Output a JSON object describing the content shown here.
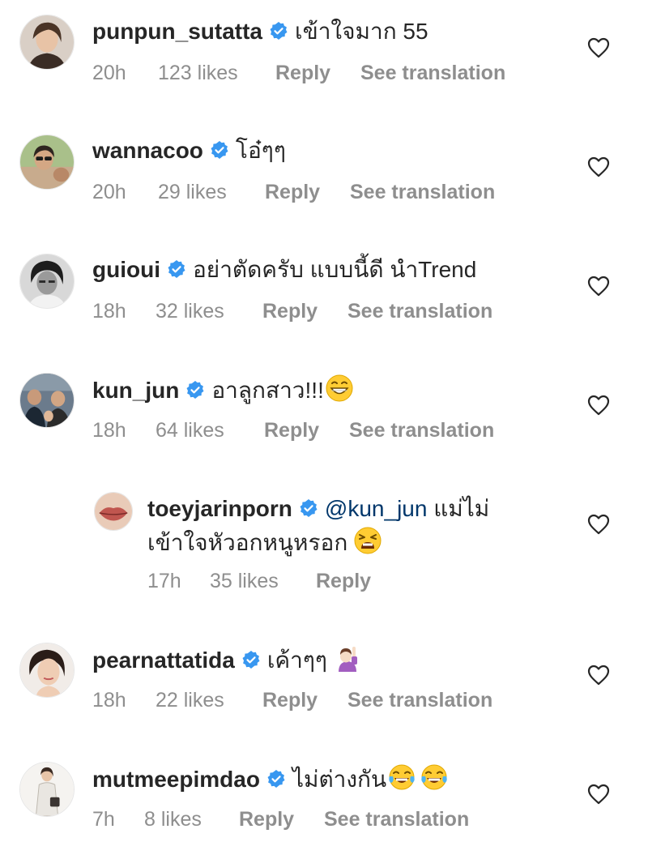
{
  "colors": {
    "text": "#262626",
    "secondary": "#8e8e8e",
    "verified": "#3897f0",
    "mention": "#00376b"
  },
  "comments": [
    {
      "username": "punpun_sutatta",
      "text": "เข้าใจมาก 55",
      "time": "20h",
      "likes": "123 likes",
      "reply": "Reply",
      "translation": "See translation",
      "avatar": "woman-portrait-avatar"
    },
    {
      "username": "wannacoo",
      "text": "โอ๋ๆๆ",
      "time": "20h",
      "likes": "29 likes",
      "reply": "Reply",
      "translation": "See translation",
      "avatar": "woman-sunglasses-avatar"
    },
    {
      "username": "guioui",
      "text": "อย่าตัดครับ แบบนี้ดี นำTrend",
      "time": "18h",
      "likes": "32 likes",
      "reply": "Reply",
      "translation": "See translation",
      "avatar": "bw-portrait-avatar"
    },
    {
      "username": "kun_jun",
      "text": "อาลูกสาว!!!",
      "time": "18h",
      "likes": "64 likes",
      "reply": "Reply",
      "translation": "See translation",
      "avatar": "group-photo-avatar",
      "emoji": "grinning-emoji"
    },
    {
      "username": "toeyjarinporn",
      "mention": "@kun_jun",
      "text_line1": " แม่ไม่",
      "text_line2": "เข้าใจหัวอกหนูหรอก",
      "time": "17h",
      "likes": "35 likes",
      "reply": "Reply",
      "avatar": "lips-avatar",
      "emoji": "tired-face-emoji"
    },
    {
      "username": "pearnattatida",
      "text": "เค้าๆๆ",
      "time": "18h",
      "likes": "22 likes",
      "reply": "Reply",
      "translation": "See translation",
      "avatar": "woman-closeup-avatar",
      "emoji": "raising-hand-emoji"
    },
    {
      "username": "mutmeepimdao",
      "text": "ไม่ต่างกัน",
      "time": "7h",
      "likes": "8 likes",
      "reply": "Reply",
      "translation": "See translation",
      "avatar": "woman-standing-avatar",
      "emoji": "tears-of-joy-emoji"
    }
  ]
}
